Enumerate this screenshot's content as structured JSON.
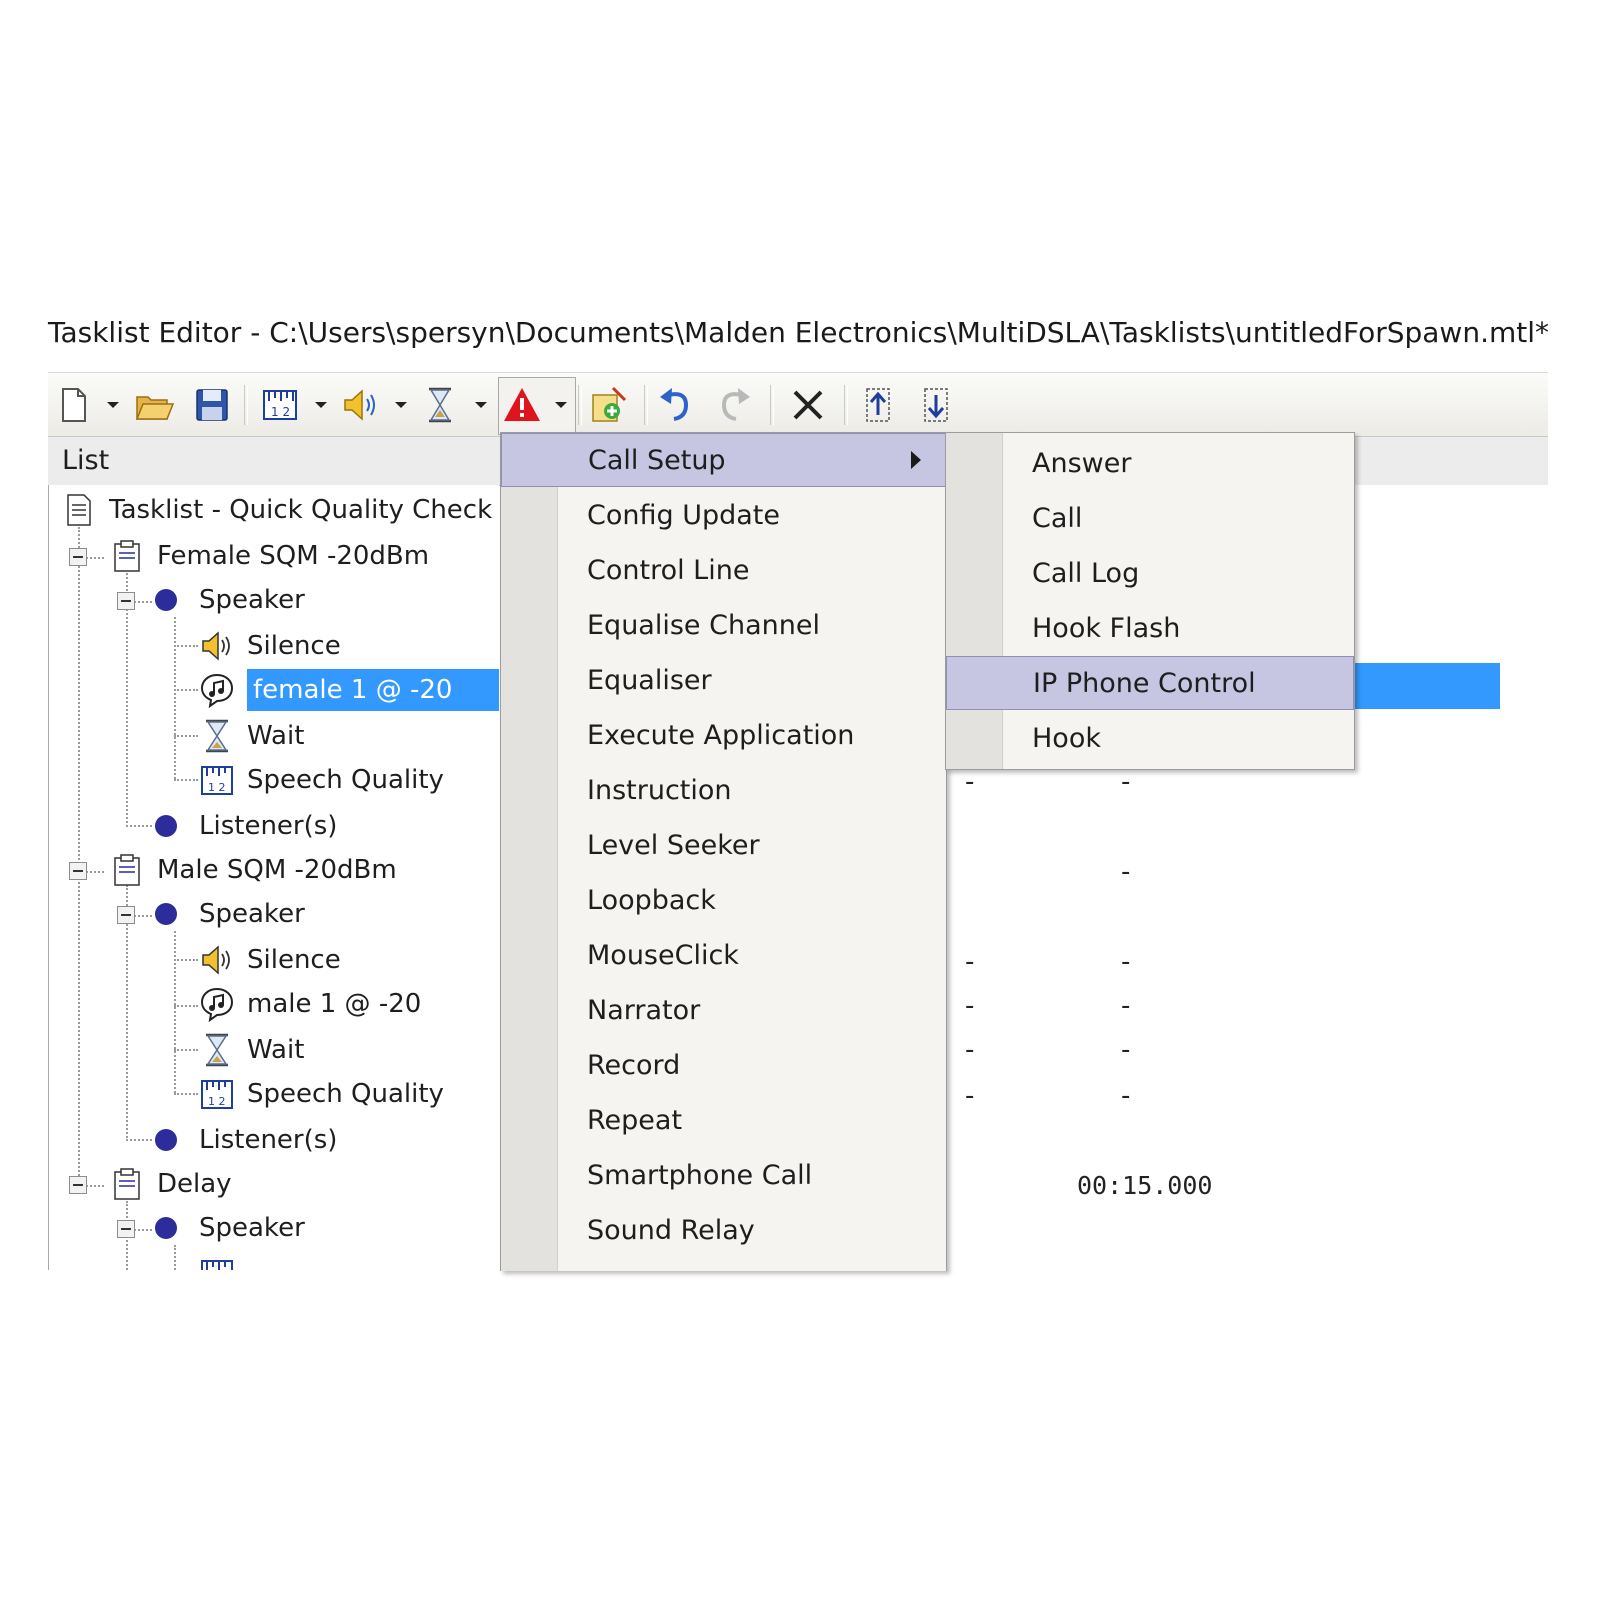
{
  "window": {
    "title": "Tasklist Editor - C:\\Users\\spersyn\\Documents\\Malden Electronics\\MultiDSLA\\Tasklists\\untitledForSpawn.mtl*"
  },
  "toolbar": {
    "buttons": [
      "new-icon",
      "open-folder-icon",
      "save-icon",
      "speech-quality-icon",
      "speaker-icon",
      "hourglass-icon",
      "warning-icon",
      "add-task-icon",
      "undo-icon",
      "redo-icon",
      "delete-icon",
      "move-up-icon",
      "move-down-icon"
    ]
  },
  "list": {
    "header": "List",
    "root": "Tasklist - Quick Quality Check",
    "groups": [
      {
        "label": "Female SQM -20dBm",
        "speaker": "Speaker",
        "items": [
          "Silence",
          "female 1 @ -20",
          "Wait",
          "Speech Quality"
        ],
        "listener": "Listener(s)"
      },
      {
        "label": "Male SQM -20dBm",
        "speaker": "Speaker",
        "items": [
          "Silence",
          "male 1 @ -20",
          "Wait",
          "Speech Quality"
        ],
        "listener": "Listener(s)"
      },
      {
        "label": "Delay",
        "speaker": "Speaker"
      }
    ],
    "selected_item": "female 1 @ -20"
  },
  "columns": {
    "dash": "-",
    "delay_time": "00:15.000"
  },
  "menu": {
    "items": [
      "Call Setup",
      "Config Update",
      "Control Line",
      "Equalise Channel",
      "Equaliser",
      "Execute Application",
      "Instruction",
      "Level Seeker",
      "Loopback",
      "MouseClick",
      "Narrator",
      "Record",
      "Repeat",
      "Smartphone Call",
      "Sound Relay"
    ],
    "highlighted": "Call Setup"
  },
  "submenu": {
    "items": [
      "Answer",
      "Call",
      "Call Log",
      "Hook Flash",
      "IP Phone Control",
      "Hook"
    ],
    "highlighted": "IP Phone Control"
  }
}
